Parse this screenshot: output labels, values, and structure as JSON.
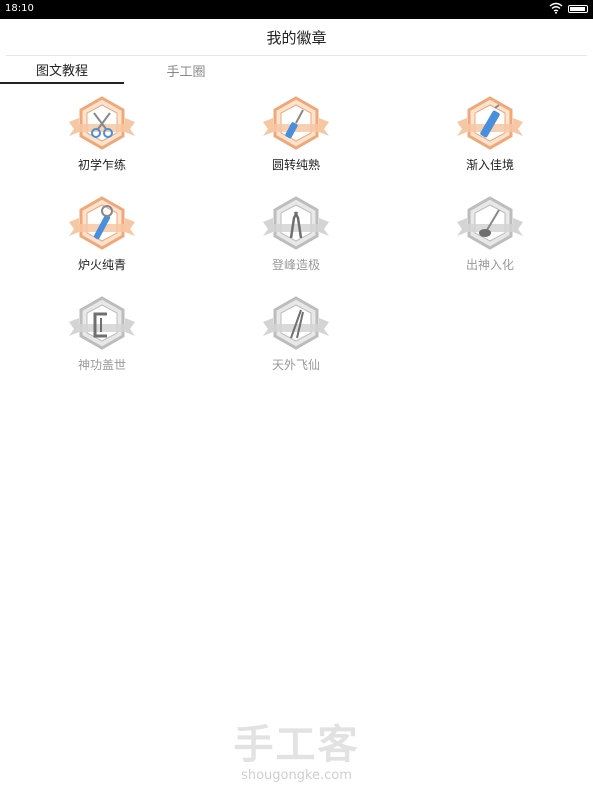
{
  "status": {
    "time": "18:10"
  },
  "header": {
    "title": "我的徽章"
  },
  "tabs": [
    {
      "label": "图文教程",
      "active": true
    },
    {
      "label": "手工圈",
      "active": false
    }
  ],
  "badges": [
    {
      "label": "初学乍练",
      "tool": "scissors-icon",
      "state": "earned"
    },
    {
      "label": "圆转纯熟",
      "tool": "screwdriver-icon",
      "state": "earned"
    },
    {
      "label": "渐入佳境",
      "tool": "cutter-icon",
      "state": "earned"
    },
    {
      "label": "炉火纯青",
      "tool": "wrench-icon",
      "state": "earned"
    },
    {
      "label": "登峰造极",
      "tool": "pliers-icon",
      "state": "locked"
    },
    {
      "label": "出神入化",
      "tool": "glue-gun-icon",
      "state": "locked"
    },
    {
      "label": "神功盖世",
      "tool": "clamp-icon",
      "state": "locked"
    },
    {
      "label": "天外飞仙",
      "tool": "tweezers-icon",
      "state": "locked"
    }
  ],
  "colors": {
    "earned_fill": "#fbe3d0",
    "earned_stroke": "#f0a878",
    "locked_fill": "#e8e8e8",
    "locked_stroke": "#bdbdbd",
    "tool_blue": "#4a8fdc"
  },
  "watermark": {
    "cn": "手工客",
    "en": "shougongke.com"
  }
}
